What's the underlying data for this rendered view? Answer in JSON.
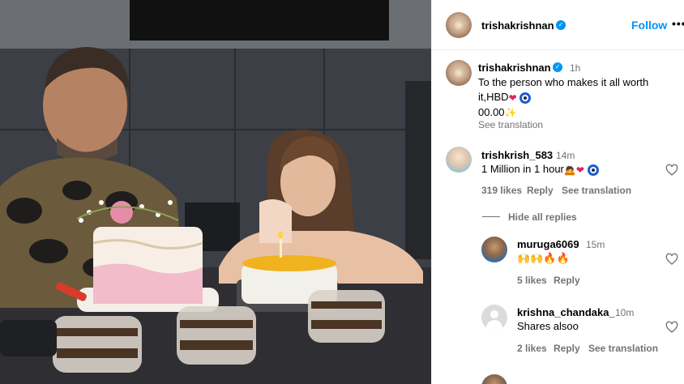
{
  "post": {
    "author": "trishakrishnan",
    "follow_label": "Follow",
    "more_label": "•••"
  },
  "caption": {
    "username": "trishakrishnan",
    "time": "1h",
    "line1": "To the person who makes it all worth",
    "line2": "it,HBD",
    "line3": "00.00",
    "see_translation": "See translation"
  },
  "comments": [
    {
      "username": "trishkrish_583",
      "time": "14m",
      "text": "1 Million in 1 hour",
      "likes": "319 likes",
      "reply": "Reply",
      "see_translation": "See translation"
    }
  ],
  "hide_replies": "Hide all replies",
  "replies": [
    {
      "username": "muruga6069",
      "time": "15m",
      "text": "🙌🙌🔥🔥",
      "likes": "5 likes",
      "reply": "Reply"
    },
    {
      "username": "krishna_chandaka_",
      "time": "10m",
      "text": "Shares alsoo",
      "likes": "2 likes",
      "reply": "Reply",
      "see_translation": "See translation"
    }
  ],
  "colors": {
    "accent": "#0095f6",
    "muted": "#737373",
    "border": "#efefef"
  }
}
